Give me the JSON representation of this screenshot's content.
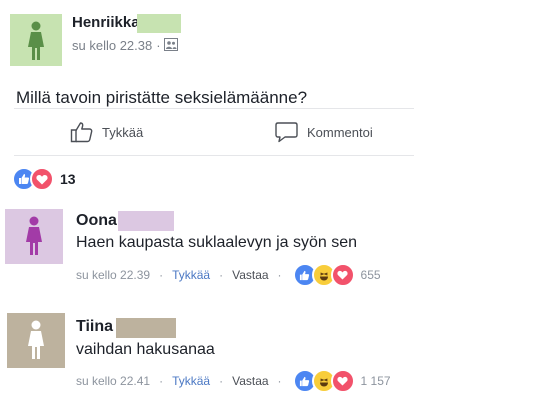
{
  "post": {
    "author": "Henriikka",
    "timestamp": "su kello 22.38",
    "text": "Millä tavoin piristätte seksielämäänne?",
    "avatar_color": "#c7e3b1",
    "actions": {
      "like_label": "Tykkää",
      "comment_label": "Kommentoi"
    },
    "reaction_count": "13"
  },
  "comments": [
    {
      "name": "Oona",
      "text": "Haen kaupasta suklaalevyn ja syön sen",
      "timestamp": "su kello 22.39",
      "like_label": "Tykkää",
      "reply_label": "Vastaa",
      "reaction_count": "655",
      "avatar_color": "#dcc8e2",
      "figure_color": "#a23ba7"
    },
    {
      "name": "Tiina",
      "text": "vaihdan hakusanaa",
      "timestamp": "su kello 22.41",
      "like_label": "Tykkää",
      "reply_label": "Vastaa",
      "reaction_count": "1 157",
      "avatar_color": "#bdb29e",
      "figure_color": "#ffffff"
    }
  ],
  "colors": {
    "like_blue": "#4c86f2",
    "love_red": "#f2526b",
    "haha_yellow": "#f8cd3b",
    "link_blue": "#4b78c4"
  }
}
